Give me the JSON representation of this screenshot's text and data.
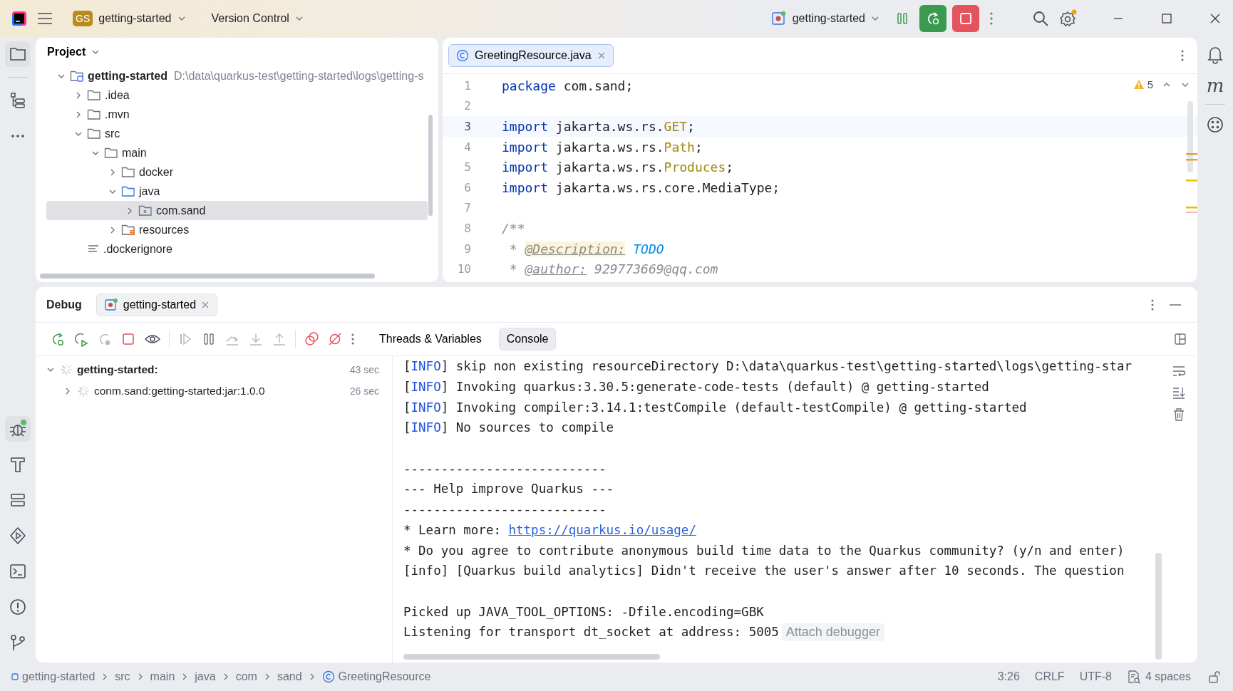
{
  "title_bar": {
    "project_badge": "GS",
    "project": "getting-started",
    "vcs": "Version Control",
    "run_config": "getting-started"
  },
  "project_panel": {
    "title": "Project",
    "tree": [
      {
        "label": "getting-started",
        "kind": "module",
        "hint": "D:\\data\\quarkus-test\\getting-started\\logs\\getting-s",
        "expanded": true,
        "selected": false,
        "children": [
          {
            "label": ".idea",
            "kind": "folder",
            "expanded": false,
            "selected": false
          },
          {
            "label": ".mvn",
            "kind": "folder",
            "expanded": false,
            "selected": false
          },
          {
            "label": "src",
            "kind": "folder",
            "expanded": true,
            "selected": false,
            "children": [
              {
                "label": "main",
                "kind": "folder",
                "expanded": true,
                "selected": false,
                "children": [
                  {
                    "label": "docker",
                    "kind": "folder",
                    "expanded": false,
                    "selected": false
                  },
                  {
                    "label": "java",
                    "kind": "source",
                    "expanded": true,
                    "selected": false,
                    "children": [
                      {
                        "label": "com.sand",
                        "kind": "package",
                        "expanded": false,
                        "selected": true
                      }
                    ]
                  },
                  {
                    "label": "resources",
                    "kind": "resources",
                    "expanded": false,
                    "selected": false
                  }
                ]
              }
            ]
          },
          {
            "label": ".dockerignore",
            "kind": "file",
            "selected": false
          }
        ]
      }
    ]
  },
  "editor": {
    "tabs": [
      {
        "label": "GreetingResource.java",
        "selected": true
      }
    ],
    "warnings": "5",
    "lines": [
      {
        "number": "1",
        "current": false,
        "tokens": [
          {
            "kind": "keyword",
            "text": "package"
          },
          {
            "kind": "plain",
            "text": " com.sand;"
          }
        ]
      },
      {
        "number": "2",
        "current": false
      },
      {
        "number": "3",
        "current": true,
        "tokens": [
          {
            "kind": "keyword",
            "text": "import"
          },
          {
            "kind": "plain",
            "text": " jakarta.ws.rs."
          },
          {
            "kind": "type",
            "text": "GET"
          },
          {
            "kind": "plain",
            "text": ";"
          }
        ]
      },
      {
        "number": "4",
        "current": false,
        "tokens": [
          {
            "kind": "keyword",
            "text": "import"
          },
          {
            "kind": "plain",
            "text": " jakarta.ws.rs."
          },
          {
            "kind": "type",
            "text": "Path"
          },
          {
            "kind": "plain",
            "text": ";"
          }
        ]
      },
      {
        "number": "5",
        "current": false,
        "tokens": [
          {
            "kind": "keyword",
            "text": "import"
          },
          {
            "kind": "plain",
            "text": " jakarta.ws.rs."
          },
          {
            "kind": "type",
            "text": "Produces"
          },
          {
            "kind": "plain",
            "text": ";"
          }
        ]
      },
      {
        "number": "6",
        "current": false,
        "tokens": [
          {
            "kind": "keyword",
            "text": "import"
          },
          {
            "kind": "plain",
            "text": " jakarta.ws.rs.core.MediaType;"
          }
        ]
      },
      {
        "number": "7",
        "current": false
      },
      {
        "number": "8",
        "current": false,
        "tokens": [
          {
            "kind": "comment",
            "text": "/**"
          }
        ]
      },
      {
        "number": "9",
        "current": false,
        "tokens": [
          {
            "kind": "comment",
            "text": " * "
          },
          {
            "kind": "doctag-marked",
            "text": "@Description:"
          },
          {
            "kind": "todo",
            "text": " TODO"
          }
        ]
      },
      {
        "number": "10",
        "current": false,
        "tokens": [
          {
            "kind": "comment",
            "text": " * "
          },
          {
            "kind": "doctag",
            "text": "@author:"
          },
          {
            "kind": "comment",
            "text": " 929773669@qq.com"
          }
        ]
      }
    ]
  },
  "debug": {
    "title": "Debug",
    "session_tab": "getting-started",
    "view_tabs": [
      {
        "label": "Threads & Variables",
        "selected": false
      },
      {
        "label": "Console",
        "selected": true
      }
    ],
    "threads": [
      {
        "label": "getting-started:",
        "time": "43 sec",
        "expanded": true,
        "children": [
          {
            "label": "conm.sand:getting-started:jar:1.0.0",
            "time": "26 sec",
            "expanded": false
          }
        ]
      }
    ],
    "console": [
      {
        "kind": "text",
        "tokens": [
          {
            "kind": "text",
            "text": "["
          },
          {
            "kind": "info",
            "text": "INFO"
          },
          {
            "kind": "text",
            "text": "] skip non existing resourceDirectory D:\\data\\quarkus-test\\getting-started\\logs\\getting-star"
          }
        ]
      },
      {
        "kind": "text",
        "tokens": [
          {
            "kind": "text",
            "text": "["
          },
          {
            "kind": "info",
            "text": "INFO"
          },
          {
            "kind": "text",
            "text": "] Invoking quarkus:3.30.5:generate-code-tests (default) @ getting-started"
          }
        ]
      },
      {
        "kind": "text",
        "tokens": [
          {
            "kind": "text",
            "text": "["
          },
          {
            "kind": "info",
            "text": "INFO"
          },
          {
            "kind": "text",
            "text": "] Invoking compiler:3.14.1:testCompile (default-testCompile) @ getting-started"
          }
        ]
      },
      {
        "kind": "text",
        "tokens": [
          {
            "kind": "text",
            "text": "["
          },
          {
            "kind": "info",
            "text": "INFO"
          },
          {
            "kind": "text",
            "text": "] No sources to compile"
          }
        ]
      },
      {
        "kind": "blank"
      },
      {
        "kind": "text",
        "tokens": [
          {
            "kind": "text",
            "text": "---------------------------"
          }
        ]
      },
      {
        "kind": "text",
        "tokens": [
          {
            "kind": "text",
            "text": "--- Help improve Quarkus ---"
          }
        ]
      },
      {
        "kind": "text",
        "tokens": [
          {
            "kind": "text",
            "text": "---------------------------"
          }
        ]
      },
      {
        "kind": "text",
        "tokens": [
          {
            "kind": "text",
            "text": "* Learn more: "
          },
          {
            "kind": "link",
            "text": "https://quarkus.io/usage/"
          }
        ]
      },
      {
        "kind": "text",
        "tokens": [
          {
            "kind": "text",
            "text": "* Do you agree to contribute anonymous build time data to the Quarkus community? (y/n and enter)"
          }
        ]
      },
      {
        "kind": "text",
        "tokens": [
          {
            "kind": "text",
            "text": "[info] [Quarkus build analytics] Didn't receive the user's answer after 10 seconds. The question"
          }
        ]
      },
      {
        "kind": "blank"
      },
      {
        "kind": "text",
        "tokens": [
          {
            "kind": "text",
            "text": "Picked up JAVA_TOOL_OPTIONS: -Dfile.encoding=GBK"
          }
        ]
      },
      {
        "kind": "text",
        "tokens": [
          {
            "kind": "text",
            "text": "Listening for transport dt_socket at address: 5005"
          },
          {
            "kind": "action",
            "text": "Attach debugger"
          }
        ]
      }
    ]
  },
  "right_strip": {
    "maven": "m"
  },
  "status_bar": {
    "breadcrumbs": [
      {
        "label": "getting-started",
        "kind": "module"
      },
      {
        "label": "src",
        "kind": "folder"
      },
      {
        "label": "main",
        "kind": "folder"
      },
      {
        "label": "java",
        "kind": "folder"
      },
      {
        "label": "com",
        "kind": "folder"
      },
      {
        "label": "sand",
        "kind": "folder"
      },
      {
        "label": "GreetingResource",
        "kind": "class"
      }
    ],
    "position": "3:26",
    "line_separator": "CRLF",
    "encoding": "UTF-8",
    "indent": "4 spaces"
  }
}
